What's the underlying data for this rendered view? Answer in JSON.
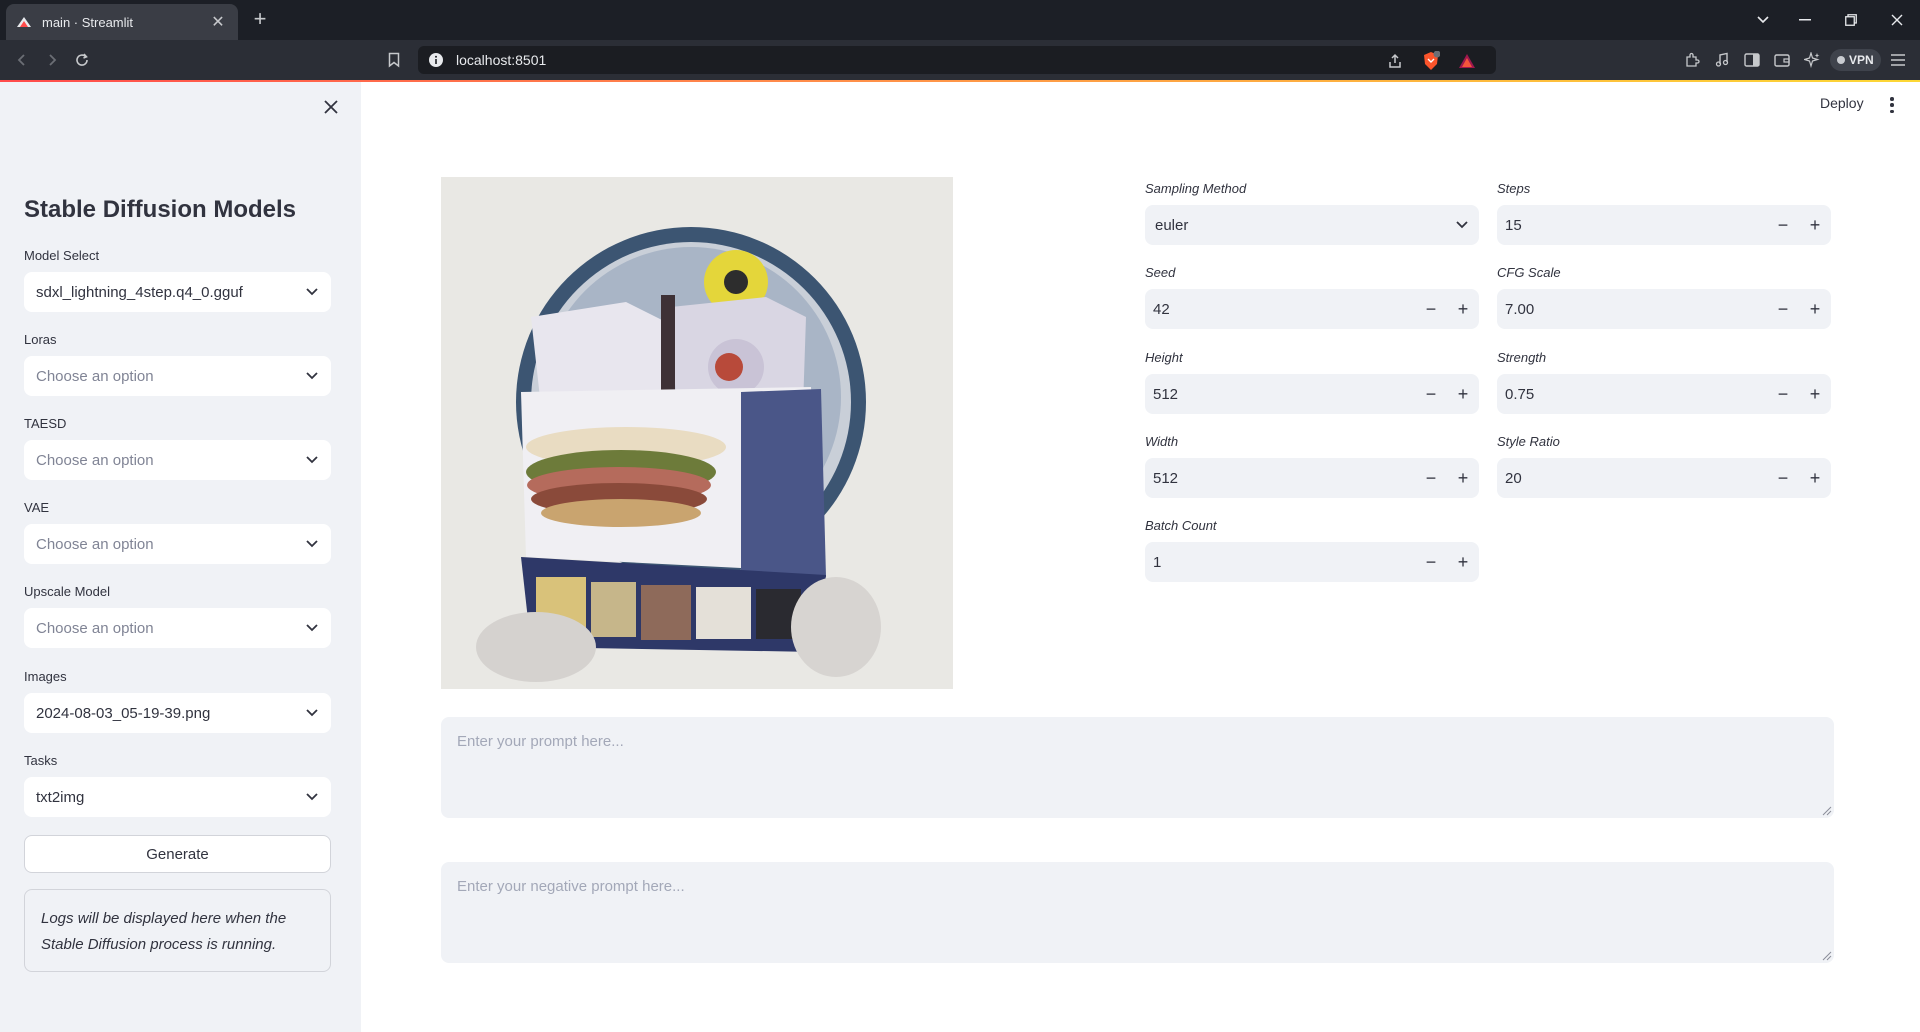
{
  "browser": {
    "tab_title": "main · Streamlit",
    "url": "localhost:8501",
    "vpn_label": "VPN",
    "shield_badge": "1"
  },
  "sidebar": {
    "title": "Stable Diffusion Models",
    "fields": [
      {
        "label": "Model Select",
        "value": "sdxl_lightning_4step.q4_0.gguf",
        "placeholder": false
      },
      {
        "label": "Loras",
        "value": "Choose an option",
        "placeholder": true
      },
      {
        "label": "TAESD",
        "value": "Choose an option",
        "placeholder": true
      },
      {
        "label": "VAE",
        "value": "Choose an option",
        "placeholder": true
      },
      {
        "label": "Upscale Model",
        "value": "Choose an option",
        "placeholder": true
      },
      {
        "label": "Images",
        "value": "2024-08-03_05-19-39.png",
        "placeholder": false
      },
      {
        "label": "Tasks",
        "value": "txt2img",
        "placeholder": false
      }
    ],
    "generate_label": "Generate",
    "logs_text": "Logs will be displayed here when the Stable Diffusion process is running."
  },
  "header": {
    "deploy_label": "Deploy"
  },
  "params": {
    "sampling_method": {
      "label": "Sampling Method",
      "value": "euler"
    },
    "steps": {
      "label": "Steps",
      "value": "15"
    },
    "seed": {
      "label": "Seed",
      "value": "42"
    },
    "cfg_scale": {
      "label": "CFG Scale",
      "value": "7.00"
    },
    "height": {
      "label": "Height",
      "value": "512"
    },
    "strength": {
      "label": "Strength",
      "value": "0.75"
    },
    "width": {
      "label": "Width",
      "value": "512"
    },
    "style_ratio": {
      "label": "Style Ratio",
      "value": "20"
    },
    "batch_count": {
      "label": "Batch Count",
      "value": "1"
    }
  },
  "prompts": {
    "positive_placeholder": "Enter your prompt here...",
    "negative_placeholder": "Enter your negative prompt here..."
  },
  "colors": {
    "accent": "#ff4b4b",
    "sidebar_bg": "#f0f2f6",
    "text": "#31333f"
  }
}
